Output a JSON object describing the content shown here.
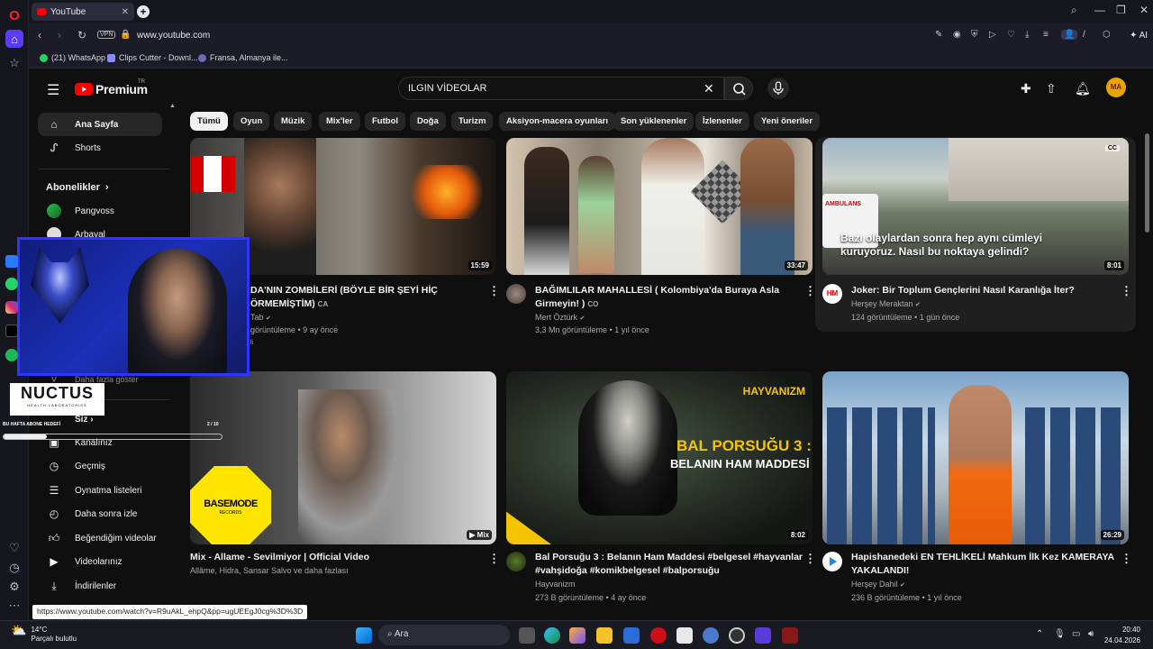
{
  "browser": {
    "tab_title": "YouTube",
    "url": "www.youtube.com",
    "vpn_label": "VPN",
    "ai_label": "AI",
    "bookmarks": [
      "(21) WhatsApp",
      "Clips Cutter - Downl...",
      "Fransa, Almanya ile..."
    ]
  },
  "youtube": {
    "logo": "Premium",
    "logo_tag": "TR",
    "search_value": "ILGIN VİDEOLAR",
    "avatar_text": "MA",
    "chips": [
      "Tümü",
      "Oyun",
      "Müzik",
      "Mix'ler",
      "Futbol",
      "Doğa",
      "Turizm",
      "Aksiyon-macera oyunları",
      "Son yüklenenler",
      "İzlenenler",
      "Yeni öneriler"
    ],
    "sidebar": {
      "home": "Ana Sayfa",
      "shorts": "Shorts",
      "subscriptions": "Abonelikler",
      "subs": [
        "Pangvoss",
        "Arbaval"
      ],
      "show_more": "Daha fazla göster",
      "you": "Siz",
      "items": [
        "Kanalınız",
        "Geçmiş",
        "Oynatma listeleri",
        "Daha sonra izle",
        "Beğendiğim videolar",
        "Videolarınız",
        "İndirilenler"
      ]
    },
    "videos": [
      {
        "title": "DA'NIN ZOMBİLERİ (BÖYLE BİR ŞEYİ HİÇ",
        "title2": "ÖRMEMİŞTİM)",
        "cc": "CA",
        "channel": "Tab",
        "meta": "görüntüleme • 9 ay önce",
        "badge": "li",
        "duration": "15:59"
      },
      {
        "title": "BAĞIMLILAR MAHALLESİ ( Kolombiya'da Buraya Asla",
        "title2": "Girmeyin! )",
        "cc": "CO",
        "channel": "Mert Öztürk",
        "meta": "3,3 Mn görüntüleme • 1 yıl önce",
        "duration": "33:47"
      },
      {
        "title": "Joker: Bir Toplum Gençlerini Nasıl Karanlığa İter?",
        "channel": "Herşey Meraktan",
        "meta": "124 görüntüleme • 1 gün önce",
        "duration": "8:01",
        "thumb_caption1": "Bazı olaylardan sonra hep aynı cümleyi",
        "thumb_caption2": "kuruyoruz. Nasıl bu noktaya gelindi?",
        "cc_badge": "CC",
        "ambulance": "AMBULANS"
      },
      {
        "title": "Mix - Allame - Sevilmiyor | Official Video",
        "channel": "Allâme, Hidra, Sansar Salvo ve daha fazlası",
        "duration": "Mix",
        "logo_text": "BASEMODE",
        "logo_sub": "RECORDS"
      },
      {
        "title": "Bal Porsuğu 3 : Belanın Ham Maddesi #belgesel #hayvanlar",
        "title2": "#vahşidoğa #komikbelgesel #balporsuğu",
        "channel": "Hayvanizm",
        "meta": "273 B görüntüleme • 4 ay önce",
        "duration": "8:02",
        "thumb_brand": "HAYVANIZM",
        "thumb_title1": "BAL PORSUĞU 3 :",
        "thumb_title2": "BELANIN HAM MADDESİ"
      },
      {
        "title": "Hapishanedeki EN TEHLİKELİ Mahkum İlk Kez KAMERAYA",
        "title2": "YAKALANDI!",
        "channel": "Herşey Dahil",
        "meta": "236 B görüntüleme • 1 yıl önce",
        "duration": "26:29"
      }
    ]
  },
  "overlay": {
    "brand": "NUCTUS",
    "brand_sub": "HEALTH LABORATORIES",
    "goal_text": "BU HAFTA ABONE HEDEFİ",
    "goal_count": "2 / 10",
    "goal_fraction": 0.2
  },
  "status_url": "https://www.youtube.com/watch?v=R9uAkL_ehpQ&pp=ugUEEgJ0cg%3D%3D",
  "taskbar": {
    "weather_temp": "14°C",
    "weather_desc": "Parçalı bulutlu",
    "search_label": "Ara",
    "time": "20:40",
    "date": "24.04.2026"
  },
  "colors": {
    "accent": "#ff0000",
    "bg": "#0f0f0f",
    "chip": "#272727"
  }
}
